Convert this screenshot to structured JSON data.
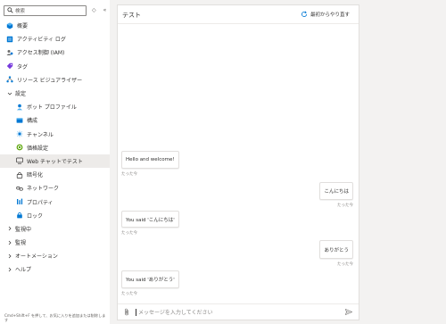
{
  "sidebar": {
    "search_placeholder": "検索",
    "items": [
      {
        "label": "概要",
        "icon": "overview-icon",
        "level": 0
      },
      {
        "label": "アクティビティ ログ",
        "icon": "activity-log-icon",
        "level": 0
      },
      {
        "label": "アクセス制御 (IAM)",
        "icon": "iam-icon",
        "level": 0
      },
      {
        "label": "タグ",
        "icon": "tag-icon",
        "level": 0
      },
      {
        "label": "リソース ビジュアライザー",
        "icon": "resource-visualizer-icon",
        "level": 0
      },
      {
        "label": "設定",
        "icon": "chevron-down-icon",
        "level": 0,
        "group": true,
        "expanded": true
      },
      {
        "label": "ボット プロファイル",
        "icon": "bot-profile-icon",
        "level": 1
      },
      {
        "label": "構成",
        "icon": "configuration-icon",
        "level": 1
      },
      {
        "label": "チャンネル",
        "icon": "channels-icon",
        "level": 1
      },
      {
        "label": "価格設定",
        "icon": "pricing-icon",
        "level": 1
      },
      {
        "label": "Web チャットでテスト",
        "icon": "web-chat-test-icon",
        "level": 1,
        "selected": true
      },
      {
        "label": "暗号化",
        "icon": "lock-icon",
        "level": 1
      },
      {
        "label": "ネットワーク",
        "icon": "network-icon",
        "level": 1
      },
      {
        "label": "プロパティ",
        "icon": "properties-icon",
        "level": 1
      },
      {
        "label": "ロック",
        "icon": "lock-blue-icon",
        "level": 1
      },
      {
        "label": "監視中",
        "icon": "chevron-right-icon",
        "level": 0,
        "group": true
      },
      {
        "label": "監視",
        "icon": "chevron-right-icon",
        "level": 0,
        "group": true
      },
      {
        "label": "オートメーション",
        "icon": "chevron-right-icon",
        "level": 0,
        "group": true
      },
      {
        "label": "ヘルプ",
        "icon": "chevron-right-icon",
        "level": 0,
        "group": true
      }
    ],
    "footer_hint": "Cmd+Shift+F を押して、お気に入りを追加または削除します"
  },
  "chat": {
    "title": "テスト",
    "restart_label": "最初からやり直す",
    "messages": [
      {
        "from": "bot",
        "text": "Hello and welcome!",
        "meta": "たった今"
      },
      {
        "from": "user",
        "text": "こんにちは",
        "meta": "たった今"
      },
      {
        "from": "bot",
        "text": "You said 'こんにちは'",
        "meta": "たった今"
      },
      {
        "from": "user",
        "text": "ありがとう",
        "meta": "たった今"
      },
      {
        "from": "bot",
        "text": "You said 'ありがとう'",
        "meta": "たった今"
      }
    ],
    "input_placeholder": "メッセージを入力してください"
  },
  "colors": {
    "accent": "#0078d4",
    "selected_bg": "#edebe9",
    "page_bg": "#f3f2f1"
  }
}
